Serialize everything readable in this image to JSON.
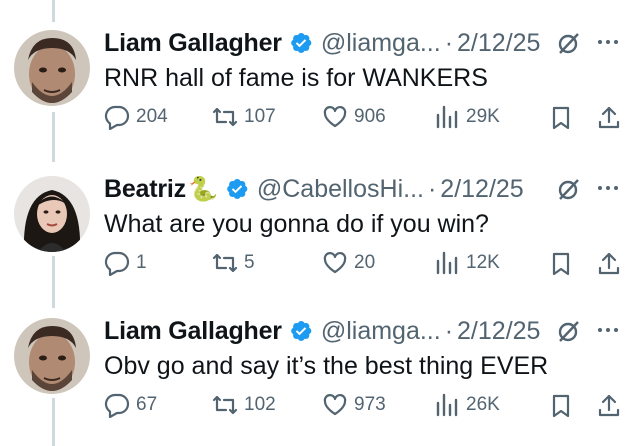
{
  "tweets": [
    {
      "name": "Liam Gallagher",
      "emoji": "",
      "handle": "@liamga...",
      "separator": "·",
      "date": "2/12/25",
      "text": "RNR hall of fame is for WANKERS",
      "replies": "204",
      "retweets": "107",
      "likes": "906",
      "views": "29K",
      "avatar": "liam"
    },
    {
      "name": "Beatriz",
      "emoji": "🐍",
      "handle": "@CabellosHi...",
      "separator": "·",
      "date": "2/12/25",
      "text": "What are you gonna do if you win?",
      "replies": "1",
      "retweets": "5",
      "likes": "20",
      "views": "12K",
      "avatar": "beatriz"
    },
    {
      "name": "Liam Gallagher",
      "emoji": "",
      "handle": "@liamga...",
      "separator": "·",
      "date": "2/12/25",
      "text": "Obv go and say it’s the best thing EVER",
      "replies": "67",
      "retweets": "102",
      "likes": "973",
      "views": "26K",
      "avatar": "liam"
    }
  ],
  "colors": {
    "verified": "#1d9bf0",
    "muted": "#536471",
    "thread_line": "#cfd9de"
  },
  "icons": [
    "reply-icon",
    "retweet-icon",
    "like-icon",
    "views-icon",
    "bookmark-icon",
    "share-icon",
    "grok-icon",
    "more-icon",
    "verified-badge-icon"
  ]
}
